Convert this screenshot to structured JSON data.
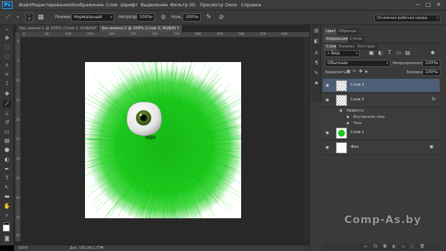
{
  "app": {
    "logo": "Ps"
  },
  "menu": [
    "Файл",
    "Редактирование",
    "Изображение",
    "Слои",
    "Шрифт",
    "Выделение",
    "Фильтр",
    "3D",
    "Просмотр",
    "Окно",
    "Справка"
  ],
  "window_controls": [
    "—",
    "□",
    "✕"
  ],
  "options": {
    "brush_size": "7",
    "mode_label": "Режим:",
    "mode_value": "Нормальный",
    "opacity_label": "Непрозр.:",
    "opacity_value": "100%",
    "flow_label": "Наж.:",
    "flow_value": "100%"
  },
  "workspace": "Основная рабочая среда",
  "tabs": [
    {
      "label": "Без имени-1 @ 100% (Слой 1, RGB/8) *"
    },
    {
      "label": "Без имени-2 @ 100% (Слой 3, RGB/8) *"
    }
  ],
  "ruler": {
    "top_ticks": [
      "0",
      "50",
      "100",
      "150",
      "200",
      "250",
      "300",
      "350",
      "400",
      "450",
      "500",
      "550",
      "600"
    ],
    "left_ticks": [
      "0",
      "5",
      "10",
      "15",
      "20",
      "25",
      "30",
      "35",
      "40",
      "45",
      "50"
    ]
  },
  "status": {
    "zoom": "100%",
    "doc": "Док: 193,3K/1,77M"
  },
  "right_panel": {
    "top_tabs": [
      "Цвет",
      "Образцы"
    ],
    "mid_tabs": [
      "Коррекция",
      "Стили"
    ],
    "layers_tabs": [
      "Слои",
      "Каналы",
      "Контуры"
    ],
    "kind_label": "Вид",
    "blend_mode": "Обычные",
    "opacity_label": "Непрозрачность:",
    "opacity_value": "100%",
    "lock_label": "Закрепить:",
    "fill_label": "Заливка:",
    "fill_value": "100%",
    "layers": [
      {
        "name": "Слой 3",
        "selected": true,
        "thumb": "checker"
      },
      {
        "name": "Слой 2",
        "selected": false,
        "thumb": "checker",
        "fx": "fx"
      },
      {
        "name": "Слой 1",
        "selected": false,
        "thumb": "green"
      },
      {
        "name": "Фон",
        "selected": false,
        "thumb": "white"
      }
    ],
    "effects": {
      "header": "Эффекты",
      "items": [
        "Внутренняя тень",
        "Тень"
      ]
    }
  },
  "watermark": "Comp-As.by",
  "colors": {
    "fur": "#19c419",
    "fur_light": "#3be03b",
    "eye_white": "#f2f2f2",
    "iris": "#5a8a1e",
    "selected_layer": "#4d5e76",
    "ui_bg": "#3a3a3a",
    "doc_bg": "#282828"
  }
}
